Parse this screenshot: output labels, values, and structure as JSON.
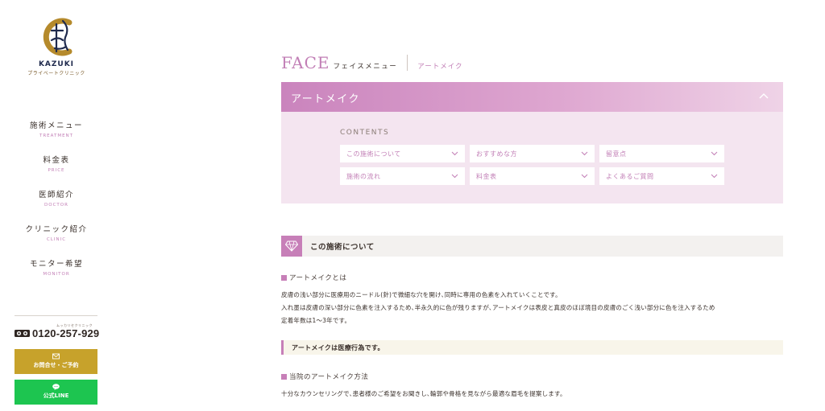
{
  "sidebar": {
    "brand_name": "KAZUKI",
    "brand_sub": "プライベートクリニック",
    "nav": [
      {
        "jp": "施術メニュー",
        "en": "TREATMENT"
      },
      {
        "jp": "料金表",
        "en": "PRICE"
      },
      {
        "jp": "医師紹介",
        "en": "DOCTOR"
      },
      {
        "jp": "クリニック紹介",
        "en": "CLINIC"
      },
      {
        "jp": "モニター希望",
        "en": "MONITOR"
      }
    ],
    "tel_tiny": "ムッカリセクリニック",
    "tel": "0120-257-929",
    "contact_label": "お問合せ・ご予約",
    "line_label": "公式LINE"
  },
  "header": {
    "title": "FACE",
    "subtitle": "フェイスメニュー",
    "breadcrumb": "アートメイク"
  },
  "panel": {
    "title": "アートメイク",
    "contents_label": "CONTENTS",
    "menu": [
      "この施術について",
      "おすすめな方",
      "留意点",
      "施術の流れ",
      "料金表",
      "よくあるご質問"
    ]
  },
  "section": {
    "title": "この施術について",
    "sub1": "アートメイクとは",
    "para1": [
      "皮膚の浅い部分に医療用のニードル(針)で微細な穴を開け､同時に専用の色素を入れていくことです。",
      "入れ墨は皮膚の深い部分に色素を注入するため､半永久的に色が残りますが､アートメイクは表皮と真皮のほぼ境目の皮膚のごく浅い部分に色を注入するため",
      "定着年数は1～3年です。"
    ],
    "note": "アートメイクは医療行為です。",
    "sub2": "当院のアートメイク方法",
    "para2": "十分なカウンセリングで､患者様のご希望をお聞きし､輪郭や骨格を見ながら最適な眉毛を提案します。"
  },
  "colors": {
    "accent": "#c27fb6",
    "gold": "#c7a22b",
    "line_green": "#1dc550",
    "panel_bg": "#f4e5f0"
  }
}
